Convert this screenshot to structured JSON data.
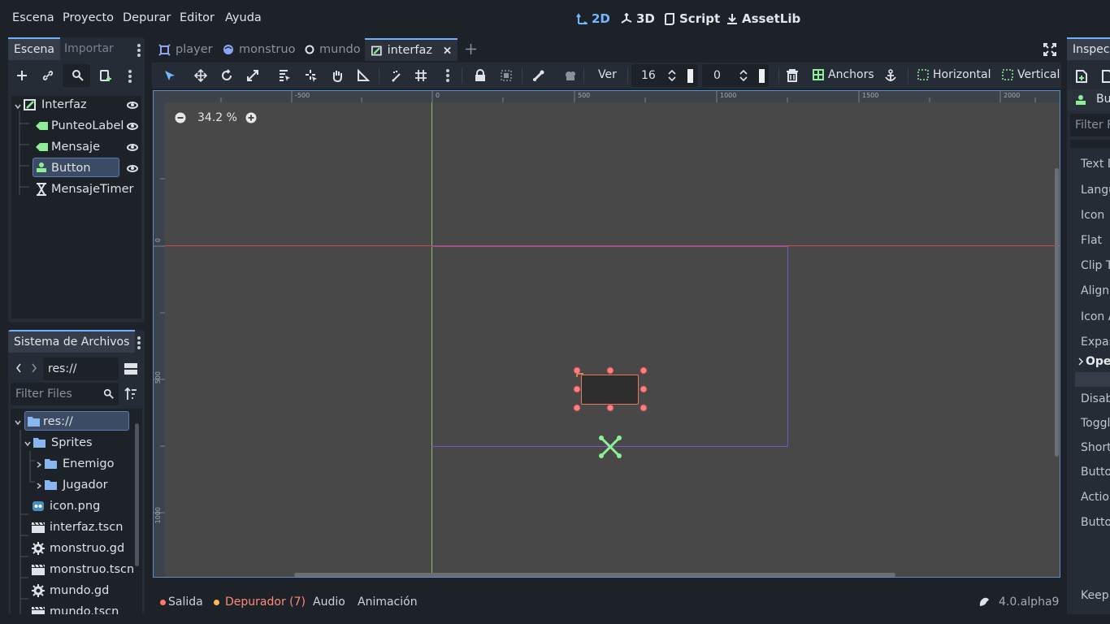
{
  "menu": [
    "Escena",
    "Proyecto",
    "Depurar",
    "Editor",
    "Ayuda"
  ],
  "workspaces": {
    "w2d": "2D",
    "w3d": "3D",
    "script": "Script",
    "assetlib": "AssetLib"
  },
  "scene_dock": {
    "tabs": [
      "Escena",
      "Importar"
    ],
    "tree": [
      {
        "label": "Interfaz"
      },
      {
        "label": "PunteoLabel"
      },
      {
        "label": "Mensaje"
      },
      {
        "label": "Button"
      },
      {
        "label": "MensajeTimer"
      }
    ]
  },
  "filesystem_dock": {
    "title": "Sistema de Archivos",
    "path": "res://",
    "filter_placeholder": "Filter Files",
    "items": [
      {
        "label": "res://"
      },
      {
        "label": "Sprites"
      },
      {
        "label": "Enemigo"
      },
      {
        "label": "Jugador"
      },
      {
        "label": "icon.png"
      },
      {
        "label": "interfaz.tscn"
      },
      {
        "label": "monstruo.gd"
      },
      {
        "label": "monstruo.tscn"
      },
      {
        "label": "mundo.gd"
      },
      {
        "label": "mundo.tscn"
      }
    ]
  },
  "editor_tabs": [
    "player",
    "monstruo",
    "mundo",
    "interfaz"
  ],
  "toolbar": {
    "view_label": "Ver",
    "grid_step": "16",
    "grid_offset": "0",
    "anchors": "Anchors",
    "horizontal": "Horizontal",
    "vertical": "Vertical"
  },
  "viewport": {
    "zoom": "34.2 %",
    "ruler_h": [
      "-500",
      "0",
      "500",
      "1000",
      "1500",
      "2000"
    ],
    "ruler_v": [
      "0",
      "500",
      "1000"
    ]
  },
  "bottom": {
    "output": "Salida",
    "debugger": "Depurador (7)",
    "audio": "Audio",
    "animation": "Animación",
    "version": "4.0.alpha9"
  },
  "inspector": {
    "title": "Inspec",
    "node": "Bu",
    "filter": "Filter F",
    "props": [
      "Text D",
      "Langu",
      "Icon",
      "Flat",
      "Clip T",
      "Align",
      "Icon A",
      "Expar",
      "Ope",
      "Disab",
      "Toggl",
      "Short",
      "Butto",
      "Action",
      "Butto",
      "Keep"
    ]
  },
  "colors": {
    "accent": "#6fb1ff",
    "error": "#ff786b",
    "warning": "#ffb65a",
    "node_green": "#8eef97"
  }
}
